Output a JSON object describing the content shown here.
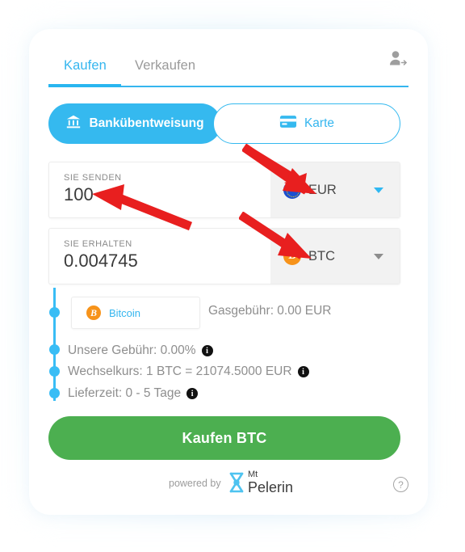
{
  "widget": {
    "tabs": [
      {
        "label": "Kaufen",
        "active": true
      },
      {
        "label": "Verkaufen",
        "active": false
      }
    ],
    "account_icon": "user-login-icon",
    "payment_methods": [
      {
        "label": "Bankübentweisung",
        "icon": "bank-icon",
        "selected": true
      },
      {
        "label": "Karte",
        "icon": "credit-card-icon",
        "selected": false
      }
    ],
    "send": {
      "label": "SIE SENDEN",
      "value": "100",
      "currency": "EUR",
      "currency_icon": "eu-flag-icon",
      "caret_color": "#2fb8f2"
    },
    "receive": {
      "label": "SIE ERHALTEN",
      "value": "0.004745",
      "currency": "BTC",
      "currency_icon": "bitcoin-icon",
      "caret_color": "#8d8d8d"
    },
    "network": {
      "label": "Bitcoin",
      "icon": "bitcoin-icon"
    },
    "gas_fee": "Gasgebühr: 0.00 EUR",
    "details": [
      {
        "text": "Unsere Gebühr: 0.00%",
        "info": "i"
      },
      {
        "text": "Wechselkurs: 1 BTC = 21074.5000 EUR",
        "info": "i"
      },
      {
        "text": "Lieferzeit: 0 - 5 Tage",
        "info": "i"
      }
    ],
    "cta_label": "Kaufen BTC",
    "footer": {
      "powered_by": "powered by",
      "brand_top": "Mt",
      "brand_bottom": "Pelerin",
      "help_icon": "?"
    },
    "colors": {
      "accent": "#35b9ef",
      "cta_green": "#4caf50",
      "bitcoin_orange": "#f7931a",
      "eu_blue": "#1c4fd0",
      "annotation_red": "#e81f1f",
      "muted_text": "#8e8e8e"
    },
    "annotations": [
      {
        "name": "arrow-to-eur-selector",
        "color": "#e81f1f"
      },
      {
        "name": "arrow-to-send-amount",
        "color": "#e81f1f"
      },
      {
        "name": "arrow-to-btc-selector",
        "color": "#e81f1f"
      }
    ]
  }
}
